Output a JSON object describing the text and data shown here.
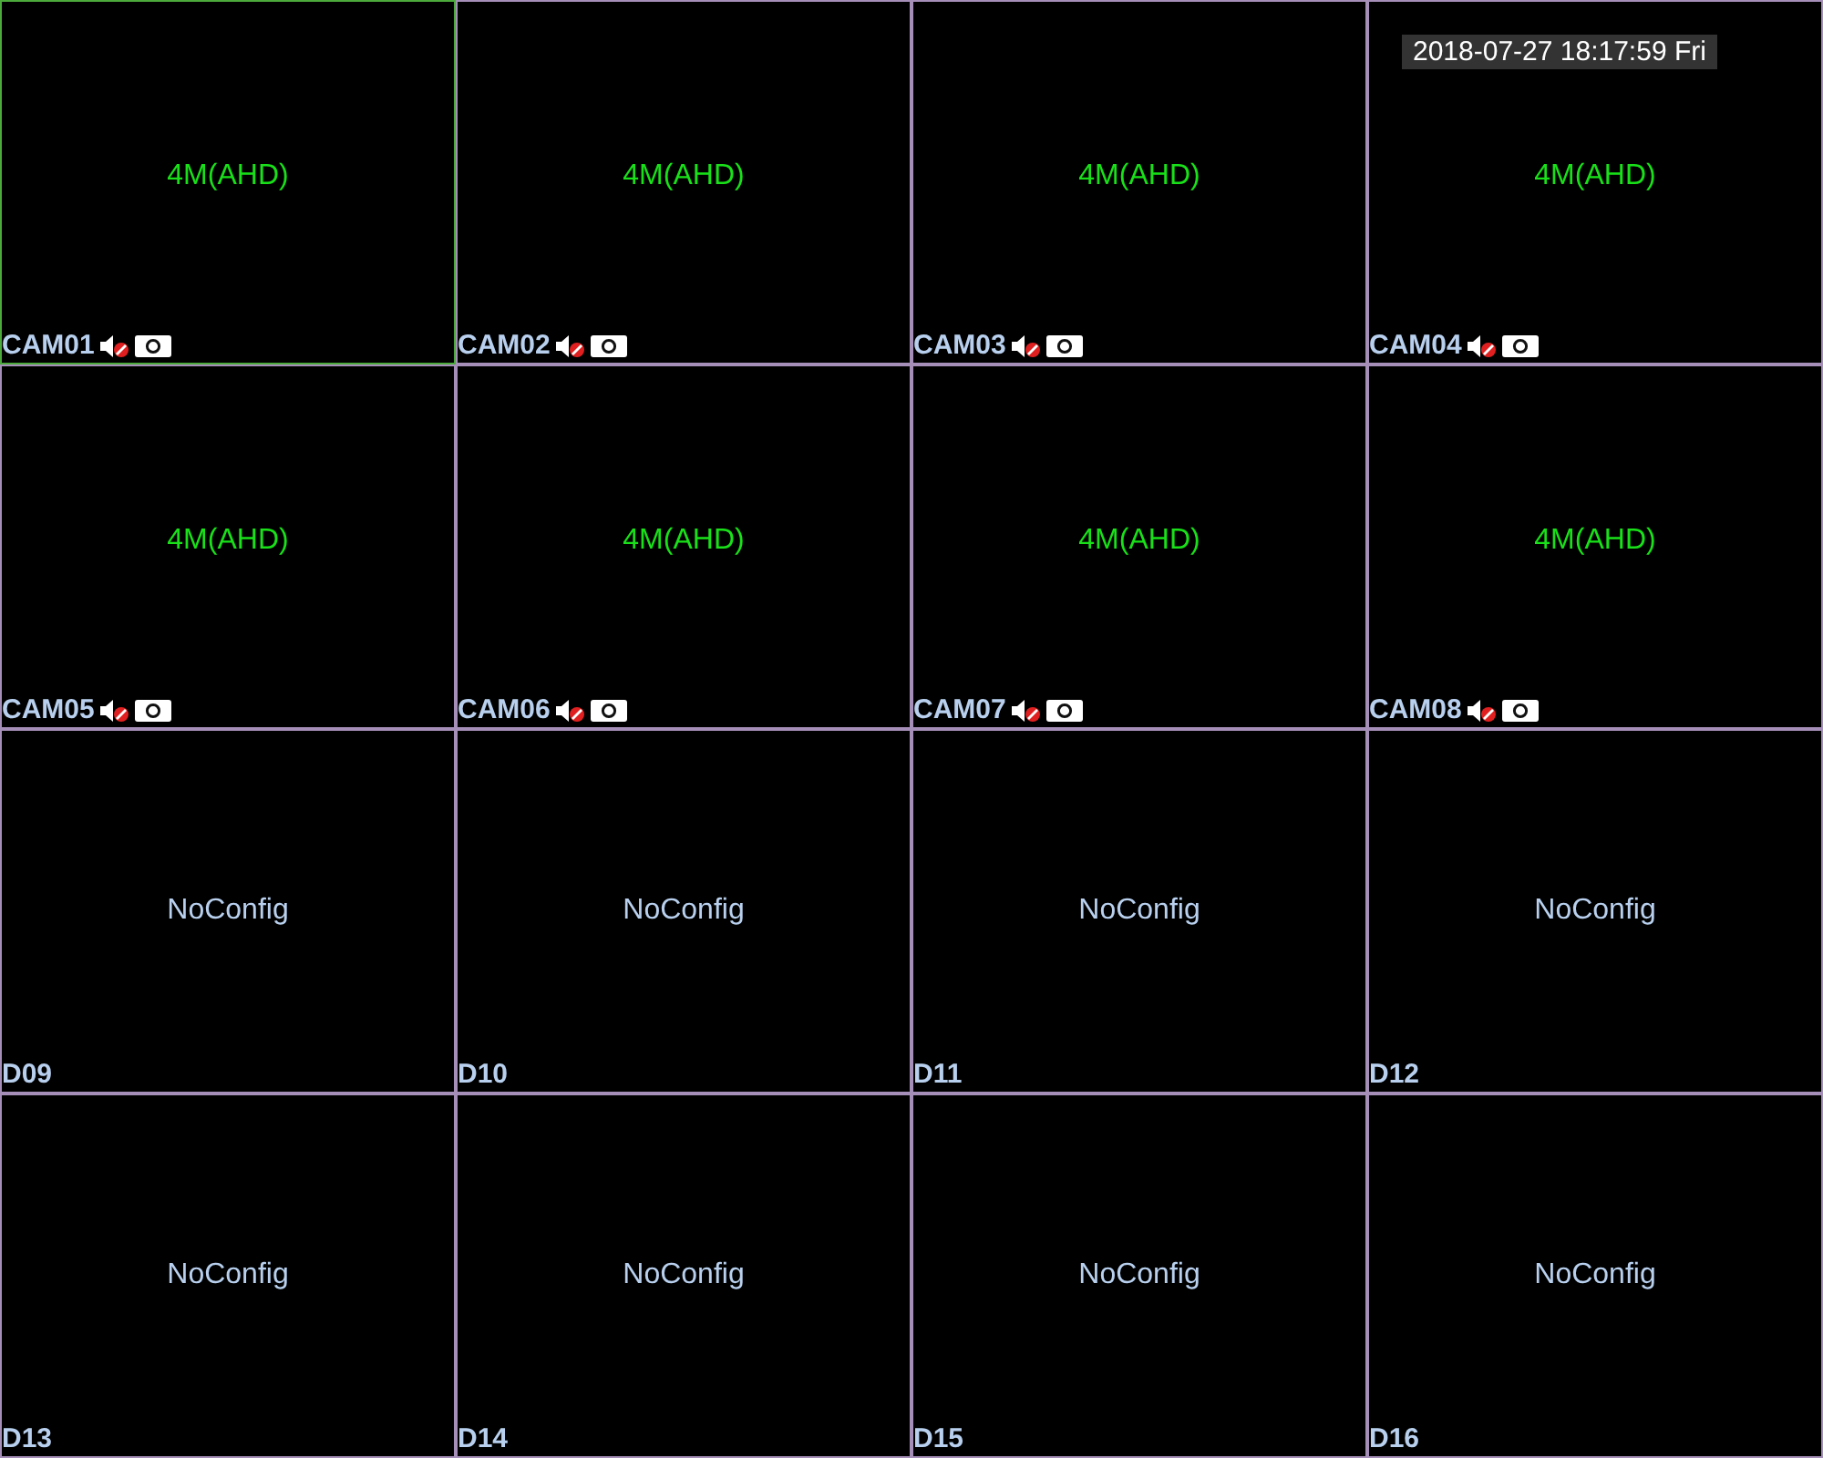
{
  "timestamp": "2018-07-27 18:17:59 Fri",
  "tiles": [
    {
      "name": "CAM01",
      "status": "4M(AHD)",
      "kind": "camera",
      "selected": true
    },
    {
      "name": "CAM02",
      "status": "4M(AHD)",
      "kind": "camera",
      "selected": false
    },
    {
      "name": "CAM03",
      "status": "4M(AHD)",
      "kind": "camera",
      "selected": false
    },
    {
      "name": "CAM04",
      "status": "4M(AHD)",
      "kind": "camera",
      "selected": false
    },
    {
      "name": "CAM05",
      "status": "4M(AHD)",
      "kind": "camera",
      "selected": false
    },
    {
      "name": "CAM06",
      "status": "4M(AHD)",
      "kind": "camera",
      "selected": false
    },
    {
      "name": "CAM07",
      "status": "4M(AHD)",
      "kind": "camera",
      "selected": false
    },
    {
      "name": "CAM08",
      "status": "4M(AHD)",
      "kind": "camera",
      "selected": false
    },
    {
      "name": "D09",
      "status": "NoConfig",
      "kind": "empty",
      "selected": false
    },
    {
      "name": "D10",
      "status": "NoConfig",
      "kind": "empty",
      "selected": false
    },
    {
      "name": "D11",
      "status": "NoConfig",
      "kind": "empty",
      "selected": false
    },
    {
      "name": "D12",
      "status": "NoConfig",
      "kind": "empty",
      "selected": false
    },
    {
      "name": "D13",
      "status": "NoConfig",
      "kind": "empty",
      "selected": false
    },
    {
      "name": "D14",
      "status": "NoConfig",
      "kind": "empty",
      "selected": false
    },
    {
      "name": "D15",
      "status": "NoConfig",
      "kind": "empty",
      "selected": false
    },
    {
      "name": "D16",
      "status": "NoConfig",
      "kind": "empty",
      "selected": false
    }
  ]
}
